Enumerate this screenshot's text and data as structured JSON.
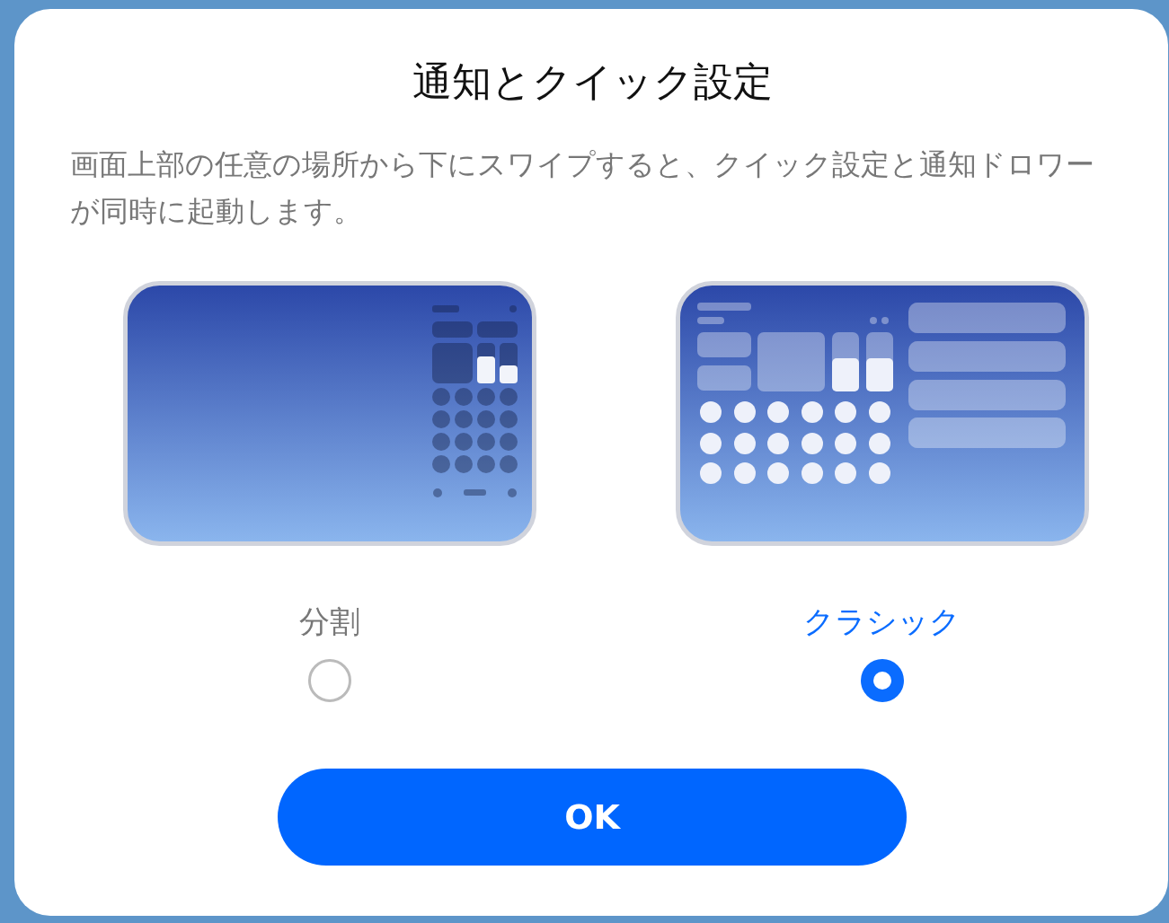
{
  "dialog": {
    "title": "通知とクイック設定",
    "description": "画面上部の任意の場所から下にスワイプすると、クイック設定と通知ドロワーが同時に起動します。"
  },
  "options": [
    {
      "kind": "split",
      "label": "分割",
      "selected": false
    },
    {
      "kind": "classic",
      "label": "クラシック",
      "selected": true
    }
  ],
  "ok_button": "OK"
}
